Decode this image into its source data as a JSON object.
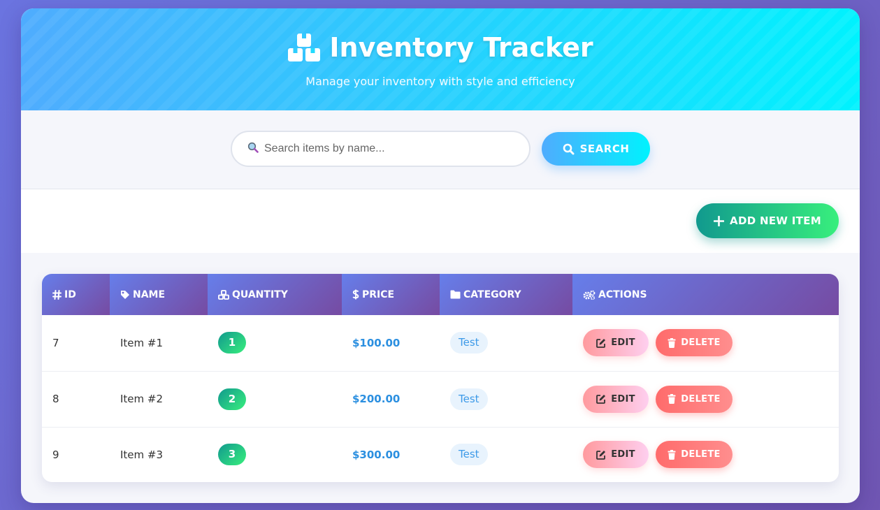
{
  "header": {
    "title": "Inventory Tracker",
    "subtitle": "Manage your inventory with style and efficiency",
    "icon": "boxes-icon"
  },
  "search": {
    "placeholder": "Search items by name...",
    "value": "",
    "button_label": "SEARCH"
  },
  "actions": {
    "add_label": "ADD NEW ITEM"
  },
  "table": {
    "columns": [
      {
        "label": "ID",
        "icon": "hash-icon"
      },
      {
        "label": "NAME",
        "icon": "tag-icon"
      },
      {
        "label": "QUANTITY",
        "icon": "cubes-icon"
      },
      {
        "label": "PRICE",
        "icon": "dollar-icon"
      },
      {
        "label": "CATEGORY",
        "icon": "folder-icon"
      },
      {
        "label": "ACTIONS",
        "icon": "cogs-icon"
      }
    ],
    "rows": [
      {
        "id": "7",
        "name": "Item #1",
        "quantity": "1",
        "price": "$100.00",
        "category": "Test"
      },
      {
        "id": "8",
        "name": "Item #2",
        "quantity": "2",
        "price": "$200.00",
        "category": "Test"
      },
      {
        "id": "9",
        "name": "Item #3",
        "quantity": "3",
        "price": "$300.00",
        "category": "Test"
      }
    ],
    "edit_label": "EDIT",
    "delete_label": "DELETE"
  },
  "colors": {
    "header_gradient": [
      "#4facfe",
      "#00f2fe"
    ],
    "table_header_gradient": [
      "#667eea",
      "#764ba2"
    ],
    "add_gradient": [
      "#11998e",
      "#38ef7d"
    ],
    "delete": "#ff6b6b",
    "price": "#2b8fe0"
  }
}
